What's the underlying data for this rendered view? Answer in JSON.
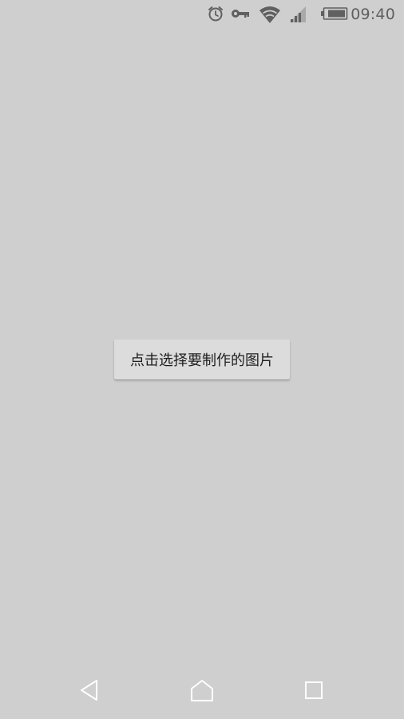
{
  "status_bar": {
    "time": "09:40",
    "icons": [
      "alarm-icon",
      "vpn-key-icon",
      "wifi-icon",
      "cell-signal-icon",
      "battery-icon"
    ]
  },
  "main": {
    "select_image_button_label": "点击选择要制作的图片"
  },
  "navigation": {
    "buttons": [
      "back-icon",
      "home-icon",
      "recents-icon"
    ]
  }
}
